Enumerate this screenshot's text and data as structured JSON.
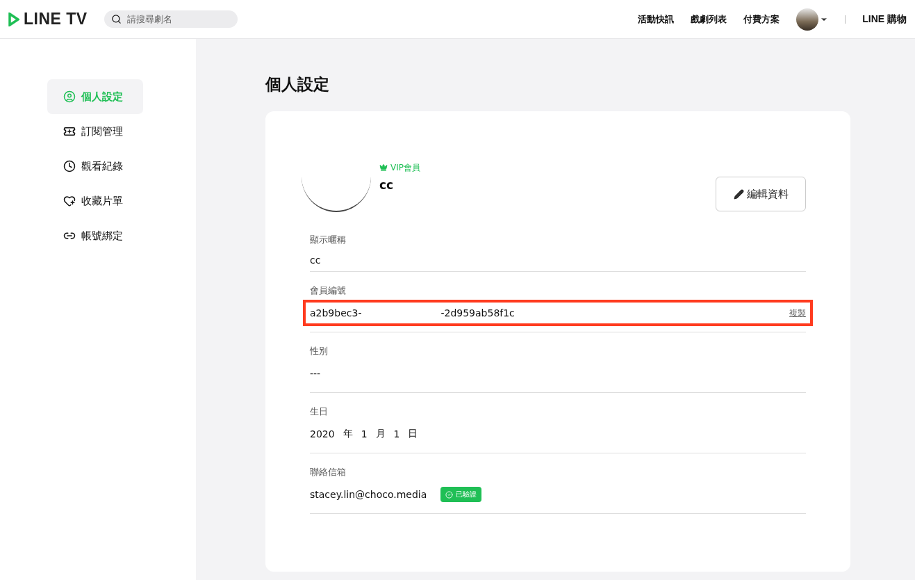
{
  "header": {
    "logo": "LINE TV",
    "search": {
      "placeholder": "請搜尋劇名"
    },
    "nav": [
      "活動快訊",
      "戲劇列表",
      "付費方案"
    ],
    "shop_link": "LINE 購物"
  },
  "sidebar": {
    "items": [
      {
        "label": "個人設定",
        "selected": true
      },
      {
        "label": "訂閱管理",
        "selected": false
      },
      {
        "label": "觀看紀錄",
        "selected": false
      },
      {
        "label": "收藏片單",
        "selected": false
      },
      {
        "label": "帳號綁定",
        "selected": false
      }
    ]
  },
  "page_title": "個人設定",
  "profile": {
    "badge": "VIP會員",
    "name": "cc",
    "edit_button": "編輯資料"
  },
  "fields": [
    {
      "kind": "text",
      "label": "顯示暱稱",
      "value": "cc",
      "highlighted": false
    },
    {
      "kind": "id",
      "label": "會員編號",
      "parts": [
        "a2b9bec3-",
        "-2d959ab58f1c"
      ],
      "action": "複製",
      "highlighted": true
    },
    {
      "kind": "text",
      "label": "性別",
      "value": "---",
      "highlighted": false
    },
    {
      "kind": "date",
      "label": "生日",
      "parts": [
        "2020",
        "年",
        "1",
        "月",
        "1",
        "日"
      ],
      "highlighted": false
    },
    {
      "kind": "email",
      "label": "聯絡信箱",
      "value": "stacey.lin@choco.media",
      "verified": "已驗證",
      "highlighted": false
    }
  ]
}
